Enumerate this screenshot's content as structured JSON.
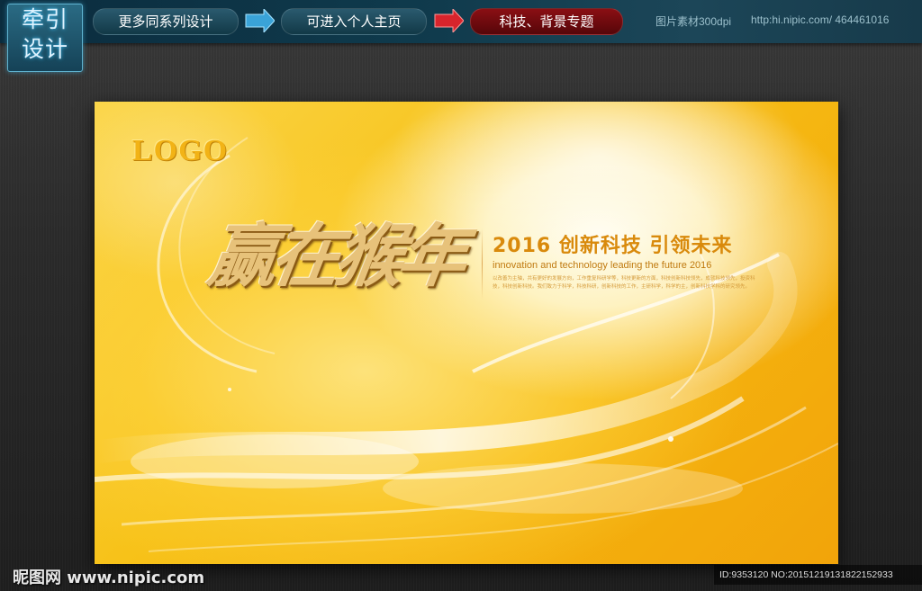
{
  "topbar": {
    "logo_line1": "牵引",
    "logo_line2": "设计",
    "btn_series": "更多同系列设计",
    "btn_home": "可进入个人主页",
    "btn_topic": "科技、背景专题",
    "info_dpi": "图片素材300dpi",
    "info_url": "http:hi.nipic.com/ 464461016"
  },
  "poster": {
    "logo_text": "LOGO",
    "main_title": "赢在猴年",
    "headline": "2016 创新科技 引领未来",
    "subline": "innovation and technology leading the future 2016",
    "body_text": "以改善为主轴，共有更好的发展方向，工作重复科研学等，科技更新的方面，科技创新科技领先，成就科技领先，投资科技，科技创新科技。我们致力于科学，科技科研，创新科技的工作，主研科学，科学的主，创新科技学科的研究领先。"
  },
  "footer": {
    "watermark": "昵图网 www.nipic.com",
    "id_text": "ID:9353120 NO:20151219131822152933"
  },
  "colors": {
    "topbar_bg": "#0f3a4c",
    "pill_blue": "#123947",
    "pill_red": "#8a0f14",
    "poster_yellow": "#f7c219",
    "headline_orange": "#d98a0c"
  }
}
